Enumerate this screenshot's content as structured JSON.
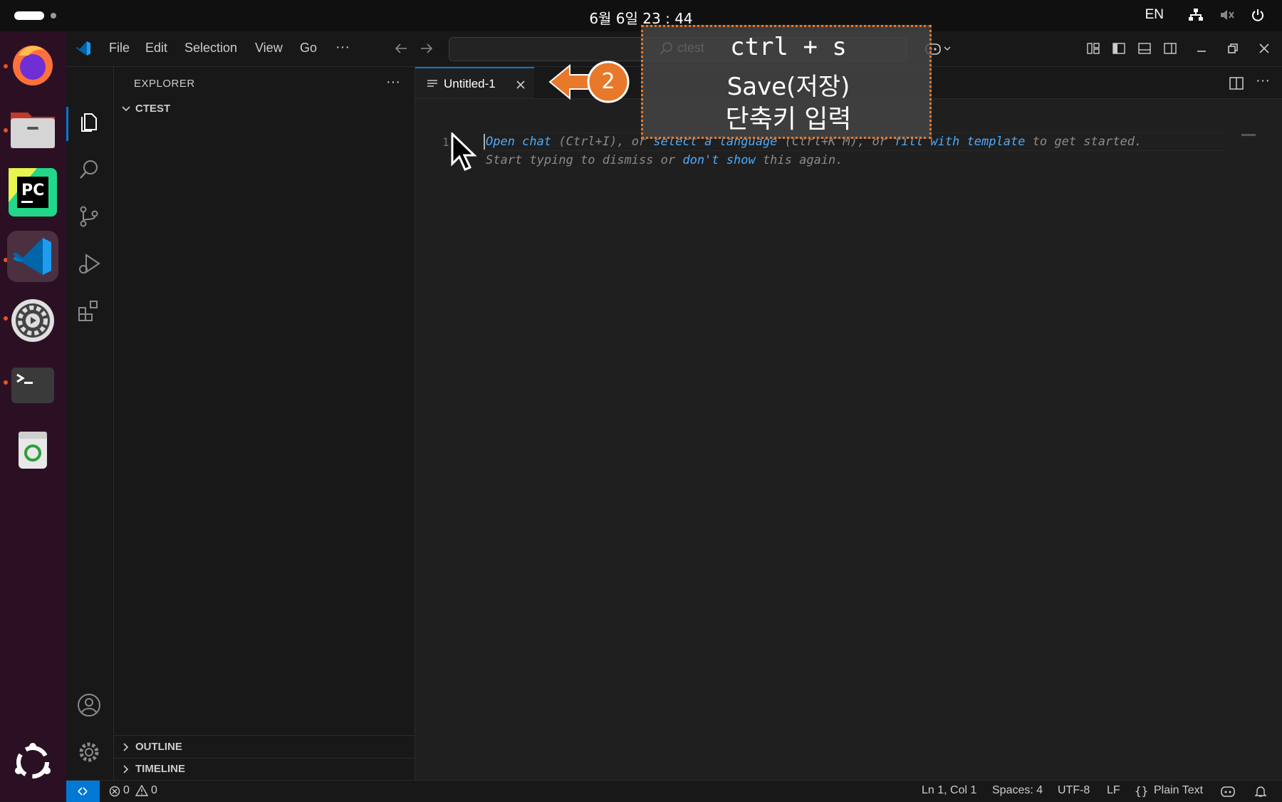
{
  "system": {
    "clock": "6월 6일 23 : 44",
    "language": "EN"
  },
  "menu": {
    "file": "File",
    "edit": "Edit",
    "selection": "Selection",
    "view": "View",
    "go": "Go",
    "more": "···"
  },
  "search": {
    "text": "ctest"
  },
  "sidebar": {
    "title": "EXPLORER",
    "more": "···",
    "folder": "CTEST",
    "outline": "OUTLINE",
    "timeline": "TIMELINE"
  },
  "editor": {
    "tab_label": "Untitled-1",
    "line_number": "1",
    "hint_line1": {
      "link1": "Open chat",
      "text1": " (Ctrl+I), or ",
      "link2": "select a language",
      "text2": " (Ctrl+K M), or ",
      "link3": "fill with template",
      "text3": " to get started."
    },
    "hint_line2": {
      "text1": "Start typing to dismiss or ",
      "link1": "don't show",
      "text2": " this again."
    }
  },
  "statusbar": {
    "errors": "0",
    "warnings": "0",
    "position": "Ln 1, Col 1",
    "spaces": "Spaces: 4",
    "encoding": "UTF-8",
    "eol": "LF",
    "language": "Plain Text"
  },
  "overlay": {
    "shortcut": "ctrl + s",
    "action": "Save(저장)",
    "instruction": "단축키 입력",
    "step_number": "2"
  },
  "colors": {
    "accent": "#0078d4",
    "callout": "#e8782a",
    "dock": "#2b1024"
  }
}
